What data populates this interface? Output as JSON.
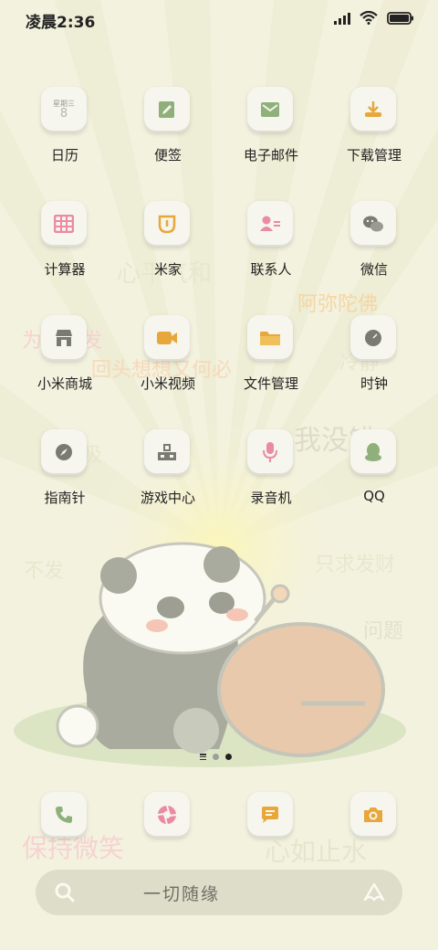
{
  "status_bar": {
    "time": "凌晨2:36",
    "icons": [
      "signal-icon",
      "wifi-icon",
      "battery-icon"
    ]
  },
  "wallpaper_text": [
    "心平气和",
    "阿弥陀佛",
    "为人人发",
    "回头想想又何必",
    "冷静",
    "我没错",
    "吸",
    "不发",
    "只求发财",
    "问题",
    "保持微笑",
    "心如止水"
  ],
  "apps": [
    {
      "label": "日历",
      "icon": "calendar-icon",
      "week": "星期三",
      "day": "8"
    },
    {
      "label": "便签",
      "icon": "notes-icon"
    },
    {
      "label": "电子邮件",
      "icon": "mail-icon"
    },
    {
      "label": "下载管理",
      "icon": "download-icon"
    },
    {
      "label": "计算器",
      "icon": "calculator-icon"
    },
    {
      "label": "米家",
      "icon": "mijia-icon"
    },
    {
      "label": "联系人",
      "icon": "contacts-icon"
    },
    {
      "label": "微信",
      "icon": "wechat-icon"
    },
    {
      "label": "小米商城",
      "icon": "store-icon"
    },
    {
      "label": "小米视频",
      "icon": "video-icon"
    },
    {
      "label": "文件管理",
      "icon": "folder-icon"
    },
    {
      "label": "时钟",
      "icon": "clock-icon"
    },
    {
      "label": "指南针",
      "icon": "compass-icon"
    },
    {
      "label": "游戏中心",
      "icon": "game-center-icon"
    },
    {
      "label": "录音机",
      "icon": "microphone-icon"
    },
    {
      "label": "QQ",
      "icon": "qq-icon"
    }
  ],
  "dock": [
    "phone-icon",
    "browser-icon",
    "messages-icon",
    "camera-icon"
  ],
  "page_indicator": {
    "pages": 2,
    "current": 2
  },
  "search": {
    "placeholder": "一切随缘"
  },
  "colors": {
    "background": "#f3f2df",
    "icon_tile": "#f6f5ee",
    "green": "#8fb07a",
    "orange": "#e7a73a",
    "pink": "#ea8aa3",
    "gray": "#7a7a72"
  }
}
